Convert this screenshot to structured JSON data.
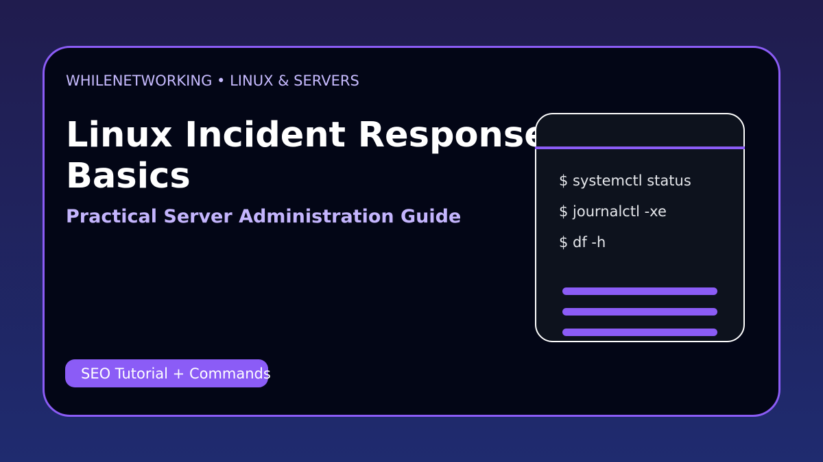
{
  "header": {
    "eyebrow": "WHILENETWORKING • LINUX & SERVERS",
    "title_line1": "Linux Incident Response",
    "title_line2": "Basics",
    "subtitle": "Practical Server Administration Guide"
  },
  "badge": {
    "label": "SEO Tutorial + Commands"
  },
  "terminal": {
    "commands": [
      "$ systemctl status",
      "$ journalctl -xe",
      "$ df -h"
    ]
  },
  "colors": {
    "accent": "#8b5cf6",
    "card_background": "#030616",
    "subtitle_text": "#c4b5fd",
    "eyebrow_text": "#c7bbff"
  }
}
